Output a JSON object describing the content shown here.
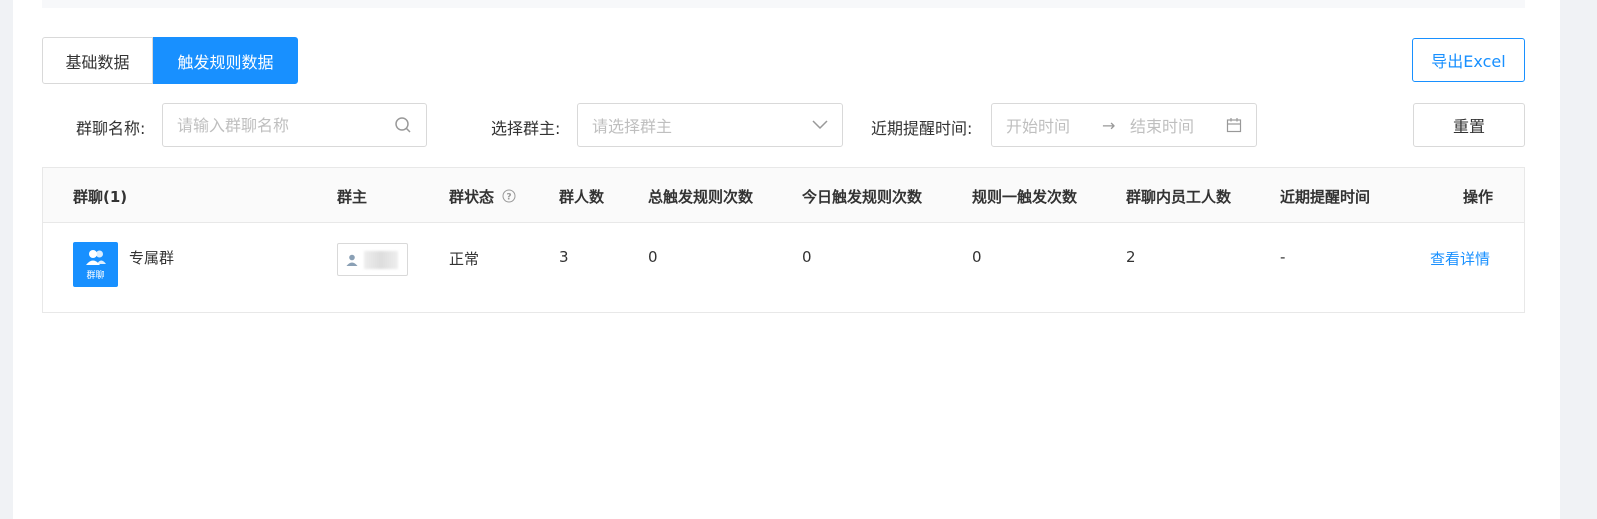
{
  "tabs": [
    {
      "label": "基础数据",
      "active": false
    },
    {
      "label": "触发规则数据",
      "active": true
    }
  ],
  "toolbar": {
    "export_label": "导出Excel",
    "reset_label": "重置"
  },
  "filters": {
    "group_name": {
      "label": "群聊名称:",
      "placeholder": "请输入群聊名称"
    },
    "owner": {
      "label": "选择群主:",
      "placeholder": "请选择群主"
    },
    "remind_time": {
      "label": "近期提醒时间:",
      "start_placeholder": "开始时间",
      "end_placeholder": "结束时间",
      "separator": "→"
    }
  },
  "table": {
    "headers": [
      "群聊(1)",
      "群主",
      "群状态",
      "群人数",
      "总触发规则次数",
      "今日触发规则次数",
      "规则一触发次数",
      "群聊内员工人数",
      "近期提醒时间",
      "操作"
    ],
    "rows": [
      {
        "avatar_label": "群聊",
        "group_name": "专属群",
        "status": "正常",
        "members": "3",
        "total_triggers": "0",
        "today_triggers": "0",
        "rule1_triggers": "0",
        "staff_count": "2",
        "last_remind": "-",
        "action": "查看详情"
      }
    ]
  },
  "colors": {
    "accent": "#1890ff",
    "border": "#d9d9d9",
    "background": "#f0f2f5"
  }
}
